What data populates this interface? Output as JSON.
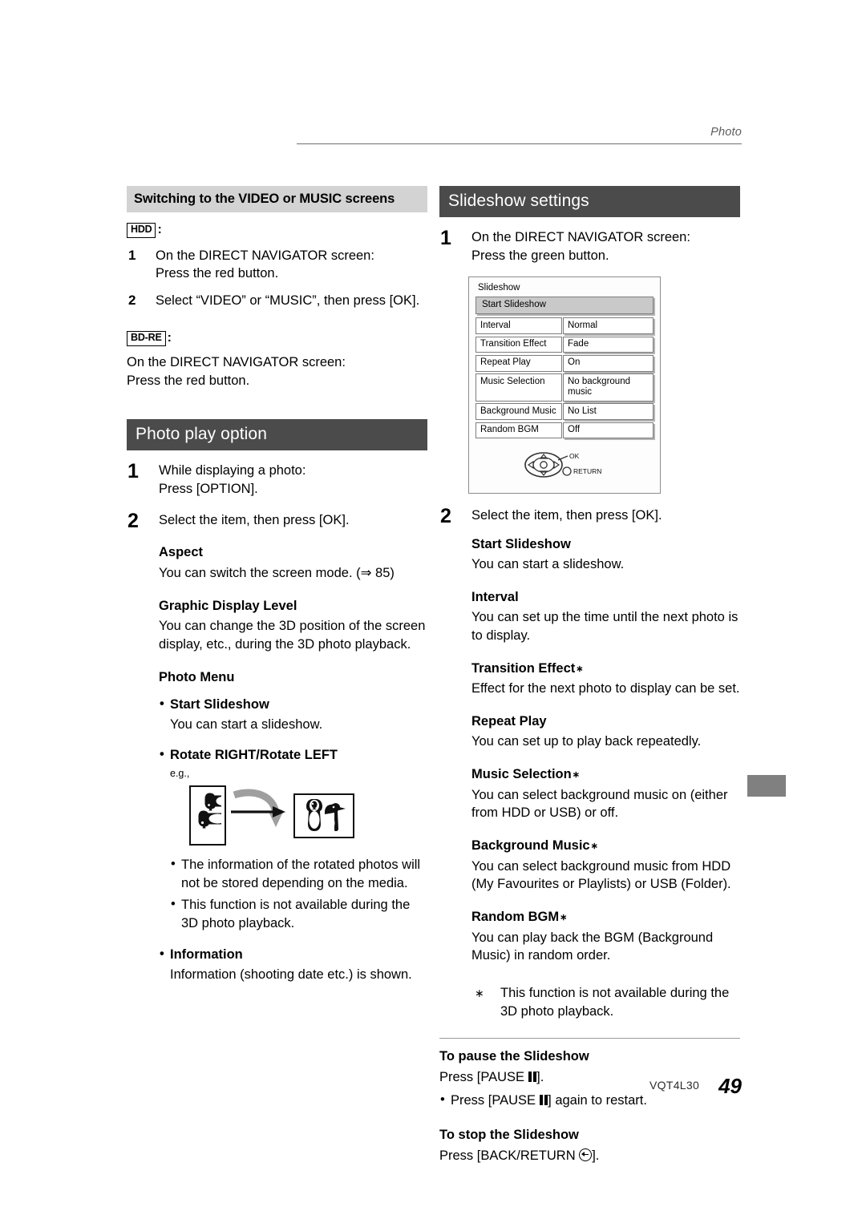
{
  "header": {
    "running_title": "Photo"
  },
  "left_column": {
    "section1": {
      "heading": "Switching to the VIDEO or MUSIC screens",
      "badge_hdd": "HDD",
      "badge_colon": ":",
      "steps": [
        {
          "num": "1",
          "line1": "On the DIRECT NAVIGATOR screen:",
          "line2": "Press the red button."
        },
        {
          "num": "2",
          "line1": "Select “VIDEO” or “MUSIC”, then press [OK].",
          "line2": ""
        }
      ],
      "badge_bdre": "BD-RE",
      "bdre_line1": "On the DIRECT NAVIGATOR screen:",
      "bdre_line2": "Press the red button."
    },
    "section2": {
      "heading": "Photo play option",
      "step1_num": "1",
      "step1_line1": "While displaying a photo:",
      "step1_line2": "Press [OPTION].",
      "step2_num": "2",
      "step2_text": "Select the item, then press [OK].",
      "items": [
        {
          "title": "Aspect",
          "body": "You can switch the screen mode. (⇒ 85)"
        },
        {
          "title": "Graphic Display Level",
          "body": "You can change the 3D position of the screen display, etc., during the 3D photo playback."
        },
        {
          "title": "Photo Menu",
          "body": ""
        }
      ],
      "photo_menu": {
        "bullet1_title": "Start Slideshow",
        "bullet1_body": "You can start a slideshow.",
        "bullet2_title": "Rotate RIGHT/Rotate LEFT",
        "eg_label": "e.g.,",
        "notes": [
          "The information of the rotated photos will not be stored depending on the media.",
          "This function is not available during the 3D photo playback."
        ],
        "bullet3_title": "Information",
        "bullet3_body": "Information (shooting date etc.) is shown."
      }
    }
  },
  "right_column": {
    "heading": "Slideshow settings",
    "step1_num": "1",
    "step1_line1": "On the DIRECT NAVIGATOR screen:",
    "step1_line2": "Press the green button.",
    "osd": {
      "title": "Slideshow",
      "highlight": "Start Slideshow",
      "rows": [
        {
          "key": "Interval",
          "value": "Normal"
        },
        {
          "key": "Transition Effect",
          "value": "Fade"
        },
        {
          "key": "Repeat Play",
          "value": "On"
        },
        {
          "key": "Music Selection",
          "value": "No background music"
        },
        {
          "key": "Background Music",
          "value": "No List"
        },
        {
          "key": "Random BGM",
          "value": "Off"
        }
      ],
      "ok_label": "OK",
      "return_label": "RETURN"
    },
    "step2_num": "2",
    "step2_text": "Select the item, then press [OK].",
    "items": [
      {
        "title": "Start Slideshow",
        "asterisk": "",
        "body": "You can start a slideshow."
      },
      {
        "title": "Interval",
        "asterisk": "",
        "body": "You can set up the time until the next photo is to display."
      },
      {
        "title": "Transition Effect",
        "asterisk": "∗",
        "body": "Effect for the next photo to display can be set."
      },
      {
        "title": "Repeat Play",
        "asterisk": "",
        "body": "You can set up to play back repeatedly."
      },
      {
        "title": "Music Selection",
        "asterisk": "∗",
        "body": "You can select background music on (either from HDD or USB) or off."
      },
      {
        "title": "Background Music",
        "asterisk": "∗",
        "body": "You can select background music from HDD (My Favourites or Playlists) or USB (Folder)."
      },
      {
        "title": "Random BGM",
        "asterisk": "∗",
        "body": "You can play back the BGM (Background Music) in random order."
      }
    ],
    "footnote_marker": "∗",
    "footnote_text": "This function is not available during the 3D photo playback.",
    "pause_heading": "To pause the Slideshow",
    "pause_line_pre": "Press [PAUSE ",
    "pause_line_post": "].",
    "pause_bullet_pre": "Press [PAUSE ",
    "pause_bullet_post": "] again to restart.",
    "stop_heading": "To stop the Slideshow",
    "stop_line_pre": "Press [BACK/RETURN ",
    "stop_line_post": "]."
  },
  "footer": {
    "code": "VQT4L30",
    "page_number": "49"
  }
}
